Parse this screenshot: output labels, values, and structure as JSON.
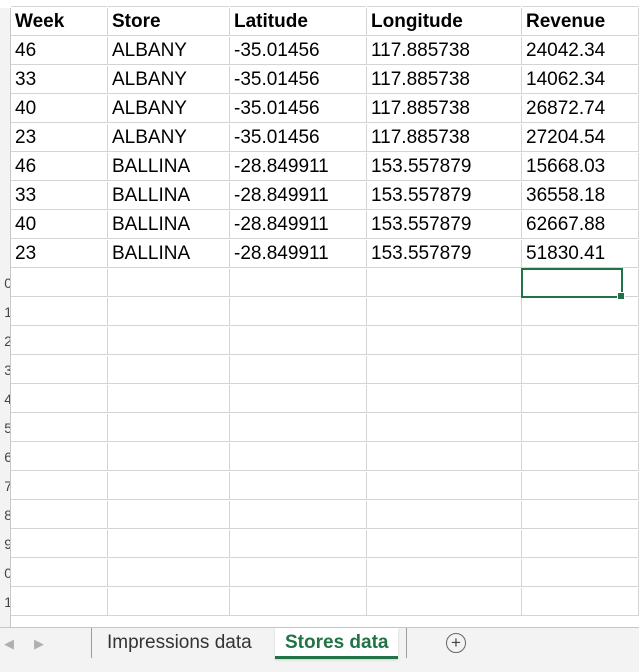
{
  "sheet": {
    "headers": [
      "Week",
      "Store",
      "Latitude",
      "Longitude",
      "Revenue"
    ],
    "rows": [
      [
        "46",
        "ALBANY",
        "-35.01456",
        "117.885738",
        "24042.34"
      ],
      [
        "33",
        "ALBANY",
        "-35.01456",
        "117.885738",
        "14062.34"
      ],
      [
        "40",
        "ALBANY",
        "-35.01456",
        "117.885738",
        "26872.74"
      ],
      [
        "23",
        "ALBANY",
        "-35.01456",
        "117.885738",
        "27204.54"
      ],
      [
        "46",
        "BALLINA",
        "-28.849911",
        "153.557879",
        "15668.03"
      ],
      [
        "33",
        "BALLINA",
        "-28.849911",
        "153.557879",
        "36558.18"
      ],
      [
        "40",
        "BALLINA",
        "-28.849911",
        "153.557879",
        "62667.88"
      ],
      [
        "23",
        "BALLINA",
        "-28.849911",
        "153.557879",
        "51830.41"
      ]
    ],
    "row_number_fragments": [
      "0",
      "1",
      "2",
      "3",
      "4",
      "5",
      "6",
      "7",
      "8",
      "9",
      "0",
      "1"
    ]
  },
  "tabs": [
    {
      "label": "Impressions data",
      "active": false
    },
    {
      "label": "Stores data",
      "active": true
    }
  ],
  "add_sheet_label": "+",
  "colors": {
    "accent": "#217346",
    "gridline": "#d4d4d4"
  }
}
